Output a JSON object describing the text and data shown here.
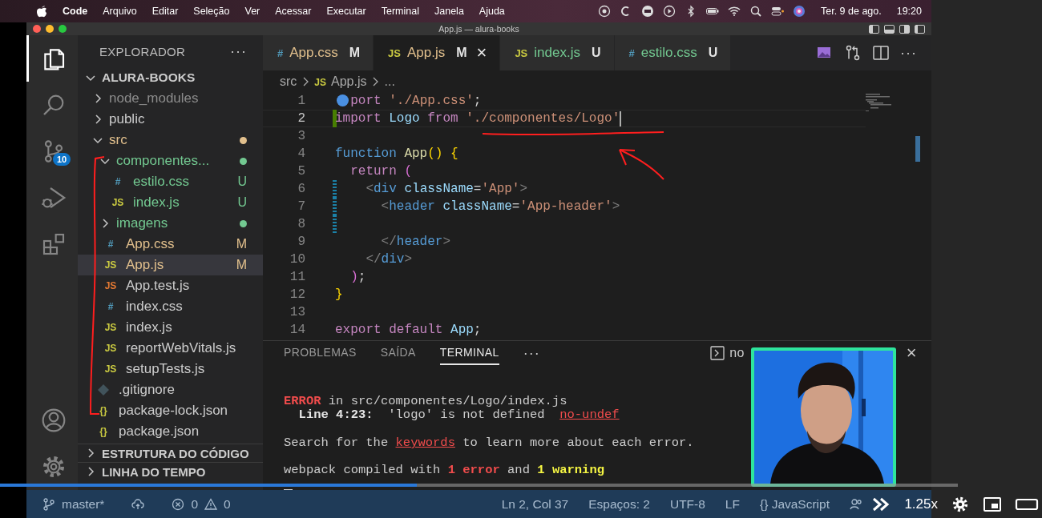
{
  "menubar": {
    "app": "Code",
    "menus": [
      "Arquivo",
      "Editar",
      "Seleção",
      "Ver",
      "Acessar",
      "Executar",
      "Terminal",
      "Janela",
      "Ajuda"
    ],
    "date": "Ter. 9 de ago.",
    "time": "19:20"
  },
  "window": {
    "title": "App.js — alura-books"
  },
  "activity_bar": {
    "items": [
      {
        "kind": "files",
        "selected": true
      },
      {
        "kind": "search",
        "selected": false
      },
      {
        "kind": "source-control",
        "selected": false,
        "badge": "10"
      },
      {
        "kind": "run",
        "selected": false
      },
      {
        "kind": "extensions",
        "selected": false
      }
    ],
    "bottom": [
      {
        "kind": "account"
      },
      {
        "kind": "settings"
      }
    ]
  },
  "sidebar": {
    "title": "EXPLORADOR",
    "more": "···",
    "project": {
      "name": "ALURA-BOOKS",
      "expanded": true,
      "children": [
        {
          "name": "node_modules",
          "kind": "folder",
          "expanded": false,
          "color": "#8c8c8c",
          "dot": false,
          "selected": false
        },
        {
          "name": "public",
          "kind": "folder",
          "expanded": false,
          "color": "#cccccc",
          "dot": false,
          "selected": false
        },
        {
          "name": "src",
          "kind": "folder",
          "expanded": true,
          "color": "#e2c08d",
          "dot": true,
          "selected": false,
          "children": [
            {
              "name": "componentes...",
              "kind": "folder",
              "expanded": true,
              "color": "#73c991",
              "dot": true,
              "selected": false,
              "children": [
                {
                  "name": "estilo.css",
                  "kind": "file",
                  "icon": {
                    "text": "#",
                    "color": "#519aba"
                  },
                  "color": "#73c991",
                  "badge": "U",
                  "selected": false
                },
                {
                  "name": "index.js",
                  "kind": "file",
                  "icon": {
                    "text": "JS",
                    "color": "#cbcb41"
                  },
                  "color": "#73c991",
                  "badge": "U",
                  "selected": false
                }
              ]
            },
            {
              "name": "imagens",
              "kind": "folder",
              "expanded": false,
              "color": "#73c991",
              "dot": true,
              "selected": false
            },
            {
              "name": "App.css",
              "kind": "file",
              "icon": {
                "text": "#",
                "color": "#519aba"
              },
              "color": "#e2c08d",
              "badge": "M",
              "selected": false
            },
            {
              "name": "App.js",
              "kind": "file",
              "icon": {
                "text": "JS",
                "color": "#cbcb41"
              },
              "color": "#e2c08d",
              "badge": "M",
              "selected": true
            },
            {
              "name": "App.test.js",
              "kind": "file",
              "icon": {
                "text": "JS",
                "color": "#e37933"
              },
              "color": "#cccccc",
              "selected": false
            },
            {
              "name": "index.css",
              "kind": "file",
              "icon": {
                "text": "#",
                "color": "#519aba"
              },
              "color": "#cccccc",
              "selected": false
            },
            {
              "name": "index.js",
              "kind": "file",
              "icon": {
                "text": "JS",
                "color": "#cbcb41"
              },
              "color": "#cccccc",
              "selected": false
            },
            {
              "name": "reportWebVitals.js",
              "kind": "file",
              "icon": {
                "text": "JS",
                "color": "#cbcb41"
              },
              "color": "#cccccc",
              "selected": false
            },
            {
              "name": "setupTests.js",
              "kind": "file",
              "icon": {
                "text": "JS",
                "color": "#cbcb41"
              },
              "color": "#cccccc",
              "selected": false
            }
          ]
        },
        {
          "name": ".gitignore",
          "kind": "file",
          "icon": {
            "color": "#41535b"
          },
          "color": "#cccccc",
          "selected": false
        },
        {
          "name": "package-lock.json",
          "kind": "file",
          "icon": {
            "text": "{}",
            "color": "#cbcb41"
          },
          "color": "#cccccc",
          "selected": false
        },
        {
          "name": "package.json",
          "kind": "file",
          "icon": {
            "text": "{}",
            "color": "#cbcb41"
          },
          "color": "#cccccc",
          "selected": false
        }
      ]
    },
    "sections": [
      {
        "title": "ESTRUTURA DO CÓDIGO",
        "expanded": false
      },
      {
        "title": "LINHA DO TEMPO",
        "expanded": false
      }
    ]
  },
  "editor": {
    "tabs": [
      {
        "icon": {
          "text": "#",
          "color": "#519aba"
        },
        "label": "App.css",
        "badge": "M",
        "color": "#e2c08d",
        "selected": false
      },
      {
        "icon": {
          "text": "JS",
          "color": "#cbcb41"
        },
        "label": "App.js",
        "badge": "M",
        "color": "#e2c08d",
        "selected": true,
        "close": "×"
      },
      {
        "icon": {
          "text": "JS",
          "color": "#cbcb41"
        },
        "label": "index.js",
        "badge": "U",
        "color": "#73c991",
        "selected": false
      },
      {
        "icon": {
          "text": "#",
          "color": "#519aba"
        },
        "label": "estilo.css",
        "badge": "U",
        "color": "#73c991",
        "selected": false
      }
    ],
    "more": "···",
    "breadcrumb": [
      {
        "label": "src"
      },
      {
        "label": "App.js",
        "icon": {
          "text": "JS",
          "color": "#cbcb41"
        }
      },
      {
        "label": "..."
      }
    ],
    "lines": [
      {
        "number": "1",
        "current": false,
        "marker": true,
        "tokens": [
          {
            "text": "port ",
            "kind": "keyword"
          },
          {
            "text": "'./App.css'",
            "kind": "string"
          },
          {
            "text": ";",
            "kind": "plain"
          }
        ]
      },
      {
        "number": "2",
        "current": true,
        "marker": false,
        "gutter": {
          "kind": "added"
        },
        "tokens": [
          {
            "text": "import",
            "kind": "keyword"
          },
          {
            "text": " Logo ",
            "kind": "variable"
          },
          {
            "text": "from",
            "kind": "keyword"
          },
          {
            "text": " './componentes/Logo'",
            "kind": "string"
          }
        ]
      },
      {
        "number": "3",
        "current": false,
        "marker": false
      },
      {
        "number": "4",
        "current": false,
        "marker": false,
        "tokens": [
          {
            "text": "function",
            "kind": "storage"
          },
          {
            "text": " App",
            "kind": "func"
          },
          {
            "text": "()",
            "kind": "bracket1"
          },
          {
            "text": " {",
            "kind": "bracket1"
          }
        ]
      },
      {
        "number": "5",
        "current": false,
        "marker": false,
        "tokens": [
          {
            "text": "  return",
            "kind": "keyword"
          },
          {
            "text": " (",
            "kind": "bracket2"
          }
        ]
      },
      {
        "number": "6",
        "current": false,
        "marker": false,
        "gutter": {
          "kind": "modified"
        },
        "tokens": [
          {
            "text": "    <",
            "kind": "punct"
          },
          {
            "text": "div",
            "kind": "tag"
          },
          {
            "text": " className",
            "kind": "attr"
          },
          {
            "text": "=",
            "kind": "plain"
          },
          {
            "text": "'App'",
            "kind": "string"
          },
          {
            "text": ">",
            "kind": "punct"
          }
        ]
      },
      {
        "number": "7",
        "current": false,
        "marker": false,
        "gutter": {
          "kind": "modified"
        },
        "tokens": [
          {
            "text": "      <",
            "kind": "punct"
          },
          {
            "text": "header",
            "kind": "tag"
          },
          {
            "text": " className",
            "kind": "attr"
          },
          {
            "text": "=",
            "kind": "plain"
          },
          {
            "text": "'App-header'",
            "kind": "string"
          },
          {
            "text": ">",
            "kind": "punct"
          }
        ]
      },
      {
        "number": "8",
        "current": false,
        "marker": false,
        "gutter": {
          "kind": "modified"
        }
      },
      {
        "number": "9",
        "current": false,
        "marker": false,
        "tokens": [
          {
            "text": "      </",
            "kind": "punct"
          },
          {
            "text": "header",
            "kind": "tag"
          },
          {
            "text": ">",
            "kind": "punct"
          }
        ]
      },
      {
        "number": "10",
        "current": false,
        "marker": false,
        "tokens": [
          {
            "text": "    </",
            "kind": "punct"
          },
          {
            "text": "div",
            "kind": "tag"
          },
          {
            "text": ">",
            "kind": "punct"
          }
        ]
      },
      {
        "number": "11",
        "current": false,
        "marker": false,
        "tokens": [
          {
            "text": "  )",
            "kind": "bracket2"
          },
          {
            "text": ";",
            "kind": "plain"
          }
        ]
      },
      {
        "number": "12",
        "current": false,
        "marker": false,
        "tokens": [
          {
            "text": "}",
            "kind": "bracket1"
          }
        ]
      },
      {
        "number": "13",
        "current": false,
        "marker": false
      },
      {
        "number": "14",
        "current": false,
        "marker": false,
        "tokens": [
          {
            "text": "export default",
            "kind": "keyword"
          },
          {
            "text": " App",
            "kind": "variable"
          },
          {
            "text": ";",
            "kind": "plain"
          }
        ]
      }
    ]
  },
  "panel": {
    "tabs": [
      {
        "label": "PROBLEMAS",
        "selected": false
      },
      {
        "label": "SAÍDA",
        "selected": false
      },
      {
        "label": "TERMINAL",
        "selected": true
      }
    ],
    "more": "···",
    "terminal_name": "no",
    "close": "×",
    "blocks": [
      {
        "lines": [
          {
            "segments": [
              {
                "text": "ERROR",
                "kind": "error"
              },
              {
                "text": " in src/componentes/Logo/index.js",
                "kind": "plain"
              }
            ]
          },
          {
            "segments": [
              {
                "text": "  Line 4:23:",
                "kind": "bold"
              },
              {
                "text": "  'logo' is not defined  ",
                "kind": "plain"
              },
              {
                "text": "no-undef",
                "kind": "link"
              }
            ]
          }
        ]
      },
      {
        "lines": [
          {
            "segments": [
              {
                "text": "Search for the ",
                "kind": "plain"
              },
              {
                "text": "keywords",
                "kind": "link"
              },
              {
                "text": " to learn more about each error.",
                "kind": "plain"
              }
            ]
          }
        ]
      },
      {
        "lines": [
          {
            "segments": [
              {
                "text": "webpack compiled with ",
                "kind": "plain"
              },
              {
                "text": "1 error",
                "kind": "error"
              },
              {
                "text": " and ",
                "kind": "plain"
              },
              {
                "text": "1 warning",
                "kind": "warning"
              }
            ]
          }
        ]
      }
    ],
    "cursor": true
  },
  "status_bar": {
    "branch": "master*",
    "errors": "0",
    "warnings": "0",
    "items": [
      "Ln 2, Col 37",
      "Espaços: 2",
      "UTF-8",
      "LF"
    ],
    "language_icon": "{}",
    "language": "JavaScript"
  },
  "annotations": [
    {
      "kind": "underline"
    },
    {
      "kind": "arrow"
    },
    {
      "kind": "bracket"
    }
  ],
  "player": {
    "progress": {
      "level": 0.435
    },
    "speed": "1.25x"
  }
}
